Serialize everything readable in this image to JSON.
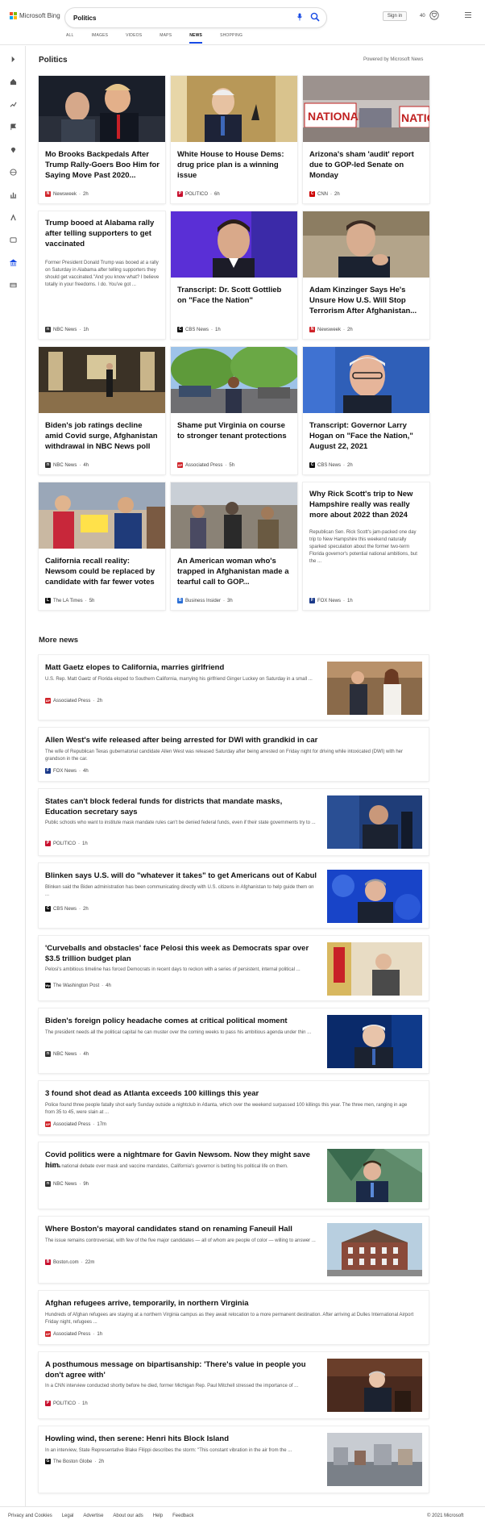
{
  "header": {
    "brand": "Microsoft Bing",
    "query": "Politics",
    "signin": "Sign in",
    "points": "40",
    "scopes": [
      "ALL",
      "IMAGES",
      "VIDEOS",
      "MAPS",
      "NEWS",
      "SHOPPING"
    ],
    "active_scope": "NEWS"
  },
  "politics": {
    "title": "Politics",
    "powered": "Powered by Microsoft News",
    "cards": [
      {
        "title": "Mo Brooks Backpedals After Trump Rally-Goers Boo Him for Saying Move Past 2020...",
        "source": "Newsweek",
        "age": "2h",
        "icon": "N",
        "icon_color": "#d0242a"
      },
      {
        "title": "White House to House Dems: drug price plan is a winning issue",
        "source": "POLITICO",
        "age": "6h",
        "icon": "P",
        "icon_color": "#c8102e"
      },
      {
        "title": "Arizona's sham 'audit' report due to GOP-led Senate on Monday",
        "source": "CNN",
        "age": "2h",
        "icon": "C",
        "icon_color": "#cc0000"
      },
      {
        "title": "Trump booed at Alabama rally after telling supporters to get vaccinated",
        "snippet": "Former President Donald Trump was booed at a rally on Saturday in Alabama after telling supporters they should get vaccinated.\"And you know what? I believe totally in your freedoms. I do. You've got ...",
        "source": "NBC News",
        "age": "1h",
        "icon": "n",
        "icon_color": "#333"
      },
      {
        "title": "Transcript: Dr. Scott Gottlieb on \"Face the Nation\"",
        "source": "CBS News",
        "age": "1h",
        "icon": "C",
        "icon_color": "#111"
      },
      {
        "title": "Adam Kinzinger Says He's Unsure How U.S. Will Stop Terrorism After Afghanistan...",
        "source": "Newsweek",
        "age": "2h",
        "icon": "N",
        "icon_color": "#d0242a"
      },
      {
        "title": "Biden's job ratings decline amid Covid surge, Afghanistan withdrawal in NBC News poll",
        "source": "NBC News",
        "age": "4h",
        "icon": "n",
        "icon_color": "#333"
      },
      {
        "title": "Shame put Virginia on course to stronger tenant protections",
        "source": "Associated Press",
        "age": "5h",
        "icon": "AP",
        "icon_color": "#d0242a"
      },
      {
        "title": "Transcript: Governor Larry Hogan on \"Face the Nation,\" August 22, 2021",
        "source": "CBS News",
        "age": "2h",
        "icon": "C",
        "icon_color": "#111"
      },
      {
        "title": "California recall reality: Newsom could be replaced by candidate with far fewer votes",
        "source": "The LA Times",
        "age": "5h",
        "icon": "L",
        "icon_color": "#111"
      },
      {
        "title": "An American woman who's trapped in Afghanistan made a tearful call to GOP...",
        "source": "Business Insider",
        "age": "3h",
        "icon": "B",
        "icon_color": "#2b6fd6"
      },
      {
        "title": "Why Rick Scott's trip to New Hampshire really was really more about 2022 than 2024",
        "snippet": "Republican Sen. Rick Scott's jam-packed one day trip to New Hampshire this weekend naturally sparked speculation about the former two-term Florida governor's potential national ambitions, but the ...",
        "source": "FOX News",
        "age": "1h",
        "icon": "F",
        "icon_color": "#1b3a8a"
      }
    ]
  },
  "more_news": {
    "title": "More news",
    "items": [
      {
        "title": "Matt Gaetz elopes to California, marries girlfriend",
        "snippet": "U.S. Rep. Matt Gaetz of Florida eloped to Southern California, marrying his girlfriend Ginger Luckey on Saturday in a small ...",
        "source": "Associated Press",
        "age": "2h",
        "icon": "AP",
        "icon_color": "#d0242a"
      },
      {
        "title": "Allen West's wife released after being arrested for DWI with grandkid in car",
        "snippet": "The wife of Republican Texas gubernatorial candidate Allen West was released Saturday after being arrested on Friday night for driving while intoxicated (DWI) with her grandson in the car.",
        "source": "FOX News",
        "age": "4h",
        "icon": "F",
        "icon_color": "#1b3a8a"
      },
      {
        "title": "States can't block federal funds for districts that mandate masks, Education secretary says",
        "snippet": "Public schools who want to institute mask mandate rules can't be denied federal funds, even if their state governments try to ...",
        "source": "POLITICO",
        "age": "1h",
        "icon": "P",
        "icon_color": "#c8102e"
      },
      {
        "title": "Blinken says U.S. will do \"whatever it takes\" to get Americans out of Kabul",
        "snippet": "Blinken said the Biden administration has been communicating directly with U.S. citizens in Afghanistan to help guide them on ...",
        "source": "CBS News",
        "age": "2h",
        "icon": "C",
        "icon_color": "#111"
      },
      {
        "title": "'Curveballs and obstacles' face Pelosi this week as Democrats spar over $3.5 trillion budget plan",
        "snippet": "Pelosi's ambitious timeline has forced Democrats in recent days to reckon with a series of persistent, internal political ...",
        "source": "The Washington Post",
        "age": "4h",
        "icon": "Wp",
        "icon_color": "#111"
      },
      {
        "title": "Biden's foreign policy headache comes at critical political moment",
        "snippet": "The president needs all the political capital he can muster over the coming weeks to pass his ambitious agenda under thin ...",
        "source": "NBC News",
        "age": "4h",
        "icon": "n",
        "icon_color": "#333"
      },
      {
        "title": "3 found shot dead as Atlanta exceeds 100 killings this year",
        "snippet": "Police found three people fatally shot early Sunday outside a nightclub in Atlanta, which over the weekend surpassed 100 killings this year. The three men, ranging in age from 35 to 45, were slain at ...",
        "source": "Associated Press",
        "age": "17m",
        "icon": "AP",
        "icon_color": "#d0242a"
      },
      {
        "title": "Covid politics were a nightmare for Gavin Newsom. Now they might save him.",
        "snippet": "Amid a national debate over mask and vaccine mandates, California's governor is betting his political life on them.",
        "source": "NBC News",
        "age": "9h",
        "icon": "n",
        "icon_color": "#333"
      },
      {
        "title": "Where Boston's mayoral candidates stand on renaming Faneuil Hall",
        "snippet": "The issue remains controversial, with few of the five major candidates — all of whom are people of color — willing to answer ...",
        "source": "Boston.com",
        "age": "22m",
        "icon": "B",
        "icon_color": "#c8102e"
      },
      {
        "title": "Afghan refugees arrive, temporarily, in northern Virginia",
        "snippet": "Hundreds of Afghan refugees are staying at a northern Virginia campus as they await relocation to a more permanent destination. After arriving at Dulles International Airport Friday night, refugees ...",
        "source": "Associated Press",
        "age": "1h",
        "icon": "AP",
        "icon_color": "#d0242a"
      },
      {
        "title": "A posthumous message on bipartisanship: 'There's value in people you don't agree with'",
        "snippet": "In a CNN interview conducted shortly before he died, former Michigan Rep. Paul Mitchell stressed the importance of ...",
        "source": "POLITICO",
        "age": "1h",
        "icon": "P",
        "icon_color": "#c8102e"
      },
      {
        "title": "Howling wind, then serene: Henri hits Block Island",
        "snippet": "In an interview, State Representative Blake Filippi describes the storm: \"This constant vibration in the air from the ...",
        "source": "The Boston Globe",
        "age": "2h",
        "icon": "G",
        "icon_color": "#111"
      }
    ]
  },
  "footer": {
    "links": [
      "Privacy and Cookies",
      "Legal",
      "Advertise",
      "About our ads",
      "Help",
      "Feedback"
    ],
    "copyright": "© 2021 Microsoft"
  },
  "colors": {
    "accent": "#174ae4",
    "card_border": "#eeeeee"
  }
}
